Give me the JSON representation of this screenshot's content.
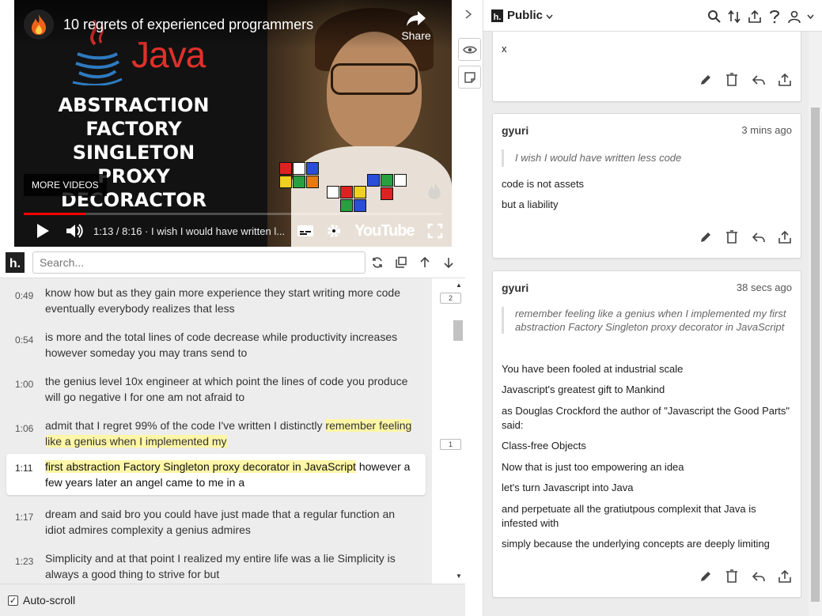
{
  "video": {
    "title": "10 regrets of experienced programmers",
    "share_label": "Share",
    "more_videos_label": "MORE VIDEOS",
    "time_text": "1:13 / 8:16 · I wish I would have written l...",
    "youtube_label": "YouTube",
    "thumbnail_brand": "Java",
    "thumbnail_lines": [
      "ABSTRACTION",
      "FACTORY",
      "SINGLETON",
      "PROXY",
      "DECORACTOR"
    ],
    "progress": 0.147
  },
  "transcript_toolbar": {
    "logo": "h.",
    "search_placeholder": "Search..."
  },
  "transcript": {
    "segments": [
      {
        "time": "0:49",
        "text": "know how but as they gain more experience they start writing more code eventually everybody realizes that less"
      },
      {
        "time": "0:54",
        "text": "is more and the total lines of code decrease while productivity increases however someday you may trans send to"
      },
      {
        "time": "1:00",
        "text": "the genius level 10x engineer at which point the lines of code you produce will go negative I for one am not afraid to"
      },
      {
        "time": "1:06",
        "text_plain": "admit that I regret 99% of the code I've written I distinctly ",
        "text_highlight": "remember feeling like a genius when I implemented my"
      },
      {
        "time": "1:11",
        "text_highlight": "first abstraction Factory Singleton proxy decorator in JavaScript",
        "text_plain": " however a few years later an angel came to me in a"
      },
      {
        "time": "1:17",
        "text": "dream and said bro you could have just made that a regular function an idiot admires complexity a genius admires"
      },
      {
        "time": "1:23",
        "text": "Simplicity and at that point I realized my entire life was a lie Simplicity is always a good thing to strive for but"
      }
    ],
    "buckets": [
      "2",
      "1"
    ],
    "autoscroll_label": "Auto-scroll",
    "autoscroll_checked": true
  },
  "sidebar": {
    "group_label": "Public",
    "cards": [
      {
        "body": [
          "x"
        ]
      },
      {
        "user": "gyuri",
        "time": "3 mins ago",
        "quote": "I wish I would have written less code",
        "body": [
          "code is not assets",
          "but a liability"
        ]
      },
      {
        "user": "gyuri",
        "time": "38 secs ago",
        "quote": "remember feeling like a genius when I implemented my first abstraction Factory Singleton proxy decorator in JavaScript",
        "body": [
          "You have been fooled at industrial scale",
          "Javascript's greatest gift to Mankind",
          "as Douglas Crockford the author of \"Javascript the Good Parts\" said:",
          "Class-free Objects",
          "Now that is just too empowering an idea",
          "let's turn Javascript into Java",
          "and perpetuate all the gratiutpous complexit that Java is infested with",
          "simply because the underlying concepts are deeply limiting"
        ]
      }
    ]
  },
  "colors": {
    "highlight": "#fdf6a6",
    "progress": "#ff0000",
    "java_red": "#e0302b",
    "panel_bg": "#ececec"
  }
}
